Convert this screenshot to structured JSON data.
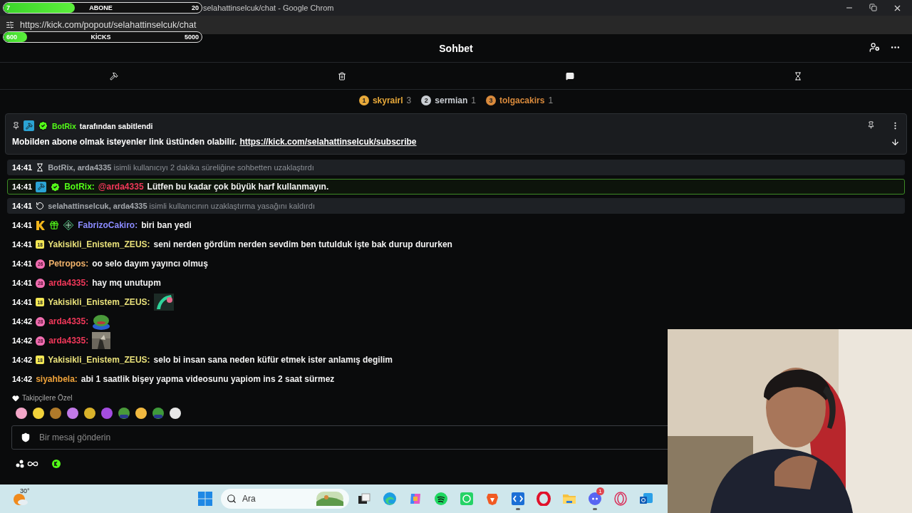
{
  "browser": {
    "title": "selahattinselcuk/chat - Google Chrom",
    "url": "https://kick.com/popout/selahattinselcuk/chat"
  },
  "goals": [
    {
      "label": "ABONE",
      "start": "7",
      "end": "20",
      "level": 0.36
    },
    {
      "label": "KİCKS",
      "start": "600",
      "end": "5000",
      "level": 0.12
    }
  ],
  "chat": {
    "title": "Sohbet"
  },
  "toolbar": [
    {
      "kind": "hammer"
    },
    {
      "kind": "trash"
    },
    {
      "kind": "chat"
    },
    {
      "kind": "hourglass"
    }
  ],
  "leaderboard": [
    {
      "rank": "1",
      "name": "skyrairl",
      "count": "3",
      "color": "#e8a93a"
    },
    {
      "rank": "2",
      "name": "sermian",
      "count": "1",
      "color": "#c9cdd2"
    },
    {
      "rank": "3",
      "name": "tolgacakirs",
      "count": "1",
      "color": "#d98a3c"
    }
  ],
  "pinned": {
    "by": "BotRix",
    "label": "tarafından sabitlendi",
    "text": "Mobilden abone olmak isteyenler link üstünden olabilir.",
    "link": "https://kick.com/selahattinselcuk/subscribe"
  },
  "messages": [
    {
      "kind": "system",
      "time": "14:41",
      "action": {
        "kind": "timeout"
      },
      "text": "**BotRix, arda4335** isimli kullanıcıyı 2 dakika süreliğine sohbetten uzaklaştırdı"
    },
    {
      "kind": "highlight",
      "time": "14:41",
      "badges": [
        {
          "kind": "moderator"
        },
        {
          "kind": "verified"
        }
      ],
      "user": "BotRix:",
      "color": "#53fc18",
      "mention": "@arda4335",
      "text": "Lütfen bu kadar çok büyük harf kullanmayın."
    },
    {
      "kind": "system",
      "time": "14:41",
      "action": {
        "kind": "unban"
      },
      "text": "**selahattinselcuk, arda4335** isimli kullanıcının uzaklaştırma yasağını kaldırdı"
    },
    {
      "kind": "normal",
      "time": "14:41",
      "badges": [
        {
          "kind": "og"
        },
        {
          "kind": "gift"
        },
        {
          "kind": "vip"
        }
      ],
      "user": "FabrizoCakiro:",
      "color": "#8b8bff",
      "text": "biri ban yedi"
    },
    {
      "kind": "normal",
      "time": "14:41",
      "badges": [
        {
          "kind": "square",
          "text": "18"
        }
      ],
      "user": "Yakisikli_Enistem_ZEUS:",
      "color": "#e8e07a",
      "text": "seni nerden gördüm nerden sevdim ben tutulduk işte bak durup dururken"
    },
    {
      "kind": "normal",
      "time": "14:41",
      "badges": [
        {
          "kind": "shield",
          "text": "26"
        }
      ],
      "user": "Petropos:",
      "color": "#f2b36b",
      "text": "oo selo dayım yayıncı olmuş"
    },
    {
      "kind": "normal",
      "time": "14:41",
      "badges": [
        {
          "kind": "shield",
          "text": "28"
        }
      ],
      "user": "arda4335:",
      "color": "#f2385a",
      "text": "hay mq unutupm"
    },
    {
      "kind": "normal",
      "time": "14:41",
      "badges": [
        {
          "kind": "square",
          "text": "18"
        }
      ],
      "user": "Yakisikli_Enistem_ZEUS:",
      "color": "#e8e07a",
      "emote": {
        "kind": "streak"
      }
    },
    {
      "kind": "normal",
      "time": "14:42",
      "badges": [
        {
          "kind": "shield",
          "text": "28"
        }
      ],
      "user": "arda4335:",
      "color": "#f2385a",
      "emote": {
        "kind": "frog"
      }
    },
    {
      "kind": "normal",
      "time": "14:42",
      "badges": [
        {
          "kind": "shield",
          "text": "28"
        }
      ],
      "user": "arda4335:",
      "color": "#f2385a",
      "emote": {
        "kind": "cat"
      }
    },
    {
      "kind": "normal",
      "time": "14:42",
      "badges": [
        {
          "kind": "square",
          "text": "18"
        }
      ],
      "user": "Yakisikli_Enistem_ZEUS:",
      "color": "#e8e07a",
      "text": "selo bi insan sana neden küfür etmek ister anlamış degilim"
    },
    {
      "kind": "normal",
      "time": "14:42",
      "user": "siyahbela:",
      "color": "#f0a33a",
      "text": "abi 1 saatlik bişey yapma videosunu yapiom ins 2 saat sürmez"
    }
  ],
  "emotes": {
    "label": "Takipçilere Özel"
  },
  "input": {
    "placeholder": "Bir mesaj gönderin"
  },
  "taskbar": {
    "weather": "30°",
    "search": "Ara",
    "apps": [
      {
        "kind": "taskview",
        "running": false
      },
      {
        "kind": "edge",
        "running": false
      },
      {
        "kind": "copilot",
        "running": false
      },
      {
        "kind": "spotify",
        "running": false
      },
      {
        "kind": "whatsapp",
        "running": false
      },
      {
        "kind": "brave",
        "running": false
      },
      {
        "kind": "blueapp",
        "running": true
      },
      {
        "kind": "opera",
        "running": false
      },
      {
        "kind": "folder",
        "running": false
      },
      {
        "kind": "discord",
        "running": true,
        "badge": "1"
      },
      {
        "kind": "operagx",
        "running": false
      },
      {
        "kind": "outlook",
        "running": false
      }
    ]
  }
}
